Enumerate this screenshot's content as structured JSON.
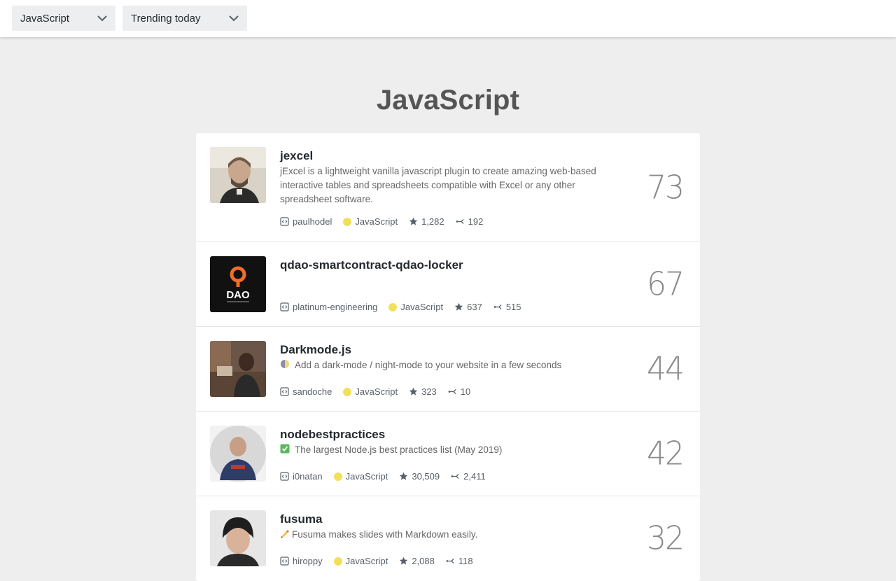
{
  "filters": {
    "language": "JavaScript",
    "date_range": "Trending today"
  },
  "page_title": "JavaScript",
  "accent_colors": {
    "language_dot": "#f1e05a"
  },
  "repos": [
    {
      "name": "jexcel",
      "description": "jExcel is a lightweight vanilla javascript plugin to create amazing web-based interactive tables and spreadsheets compatible with Excel or any other spreadsheet software.",
      "emoji": "",
      "owner": "paulhodel",
      "language": "JavaScript",
      "stars": "1,282",
      "forks": "192",
      "score": "73"
    },
    {
      "name": "qdao-smartcontract-qdao-locker",
      "description": "",
      "emoji": "",
      "owner": "platinum-engineering",
      "language": "JavaScript",
      "stars": "637",
      "forks": "515",
      "score": "67",
      "avatar_text": "DAO"
    },
    {
      "name": "Darkmode.js",
      "description": "Add a dark-mode / night-mode to your website in a few seconds",
      "emoji": "half-moon-icon",
      "owner": "sandoche",
      "language": "JavaScript",
      "stars": "323",
      "forks": "10",
      "score": "44"
    },
    {
      "name": "nodebestpractices",
      "description": "The largest Node.js best practices list (May 2019)",
      "emoji": "check-mark-icon",
      "owner": "i0natan",
      "language": "JavaScript",
      "stars": "30,509",
      "forks": "2,411",
      "score": "42"
    },
    {
      "name": "fusuma",
      "description": "Fusuma makes slides with Markdown easily.",
      "emoji": "writing-hand-icon",
      "owner": "hiroppy",
      "language": "JavaScript",
      "stars": "2,088",
      "forks": "118",
      "score": "32"
    }
  ]
}
